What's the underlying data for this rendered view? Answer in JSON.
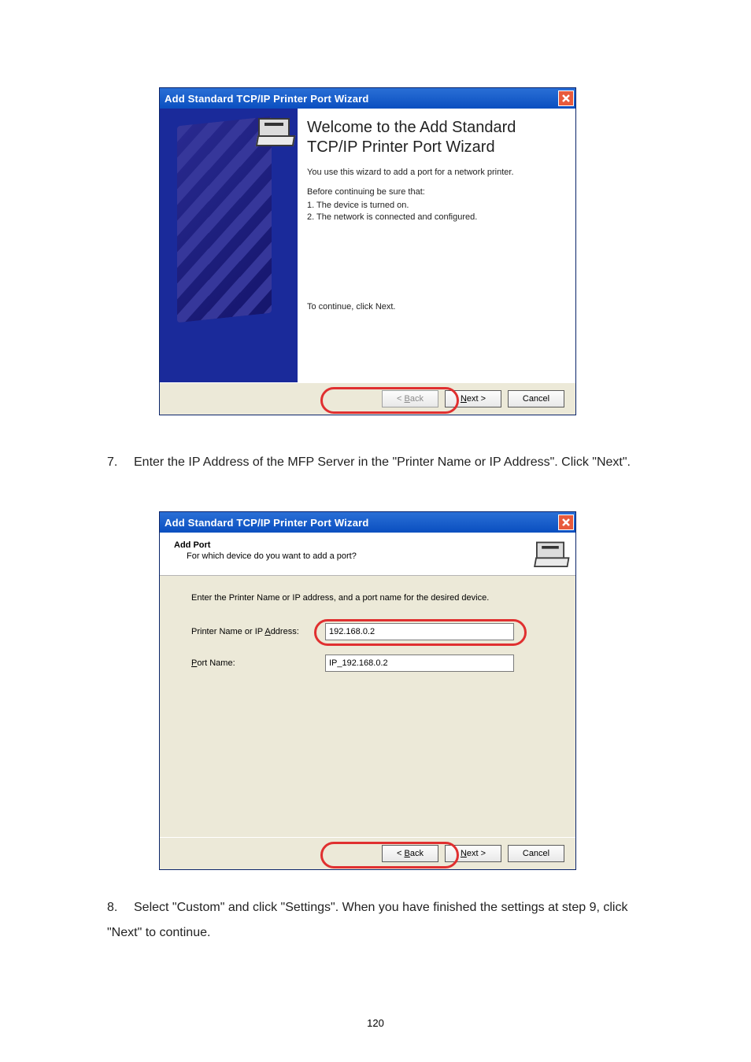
{
  "wizard_title": "Add Standard TCP/IP Printer Port Wizard",
  "close_glyph": "X",
  "dlg1": {
    "heading": "Welcome to the Add Standard TCP/IP Printer Port Wizard",
    "intro": "You use this wizard to add a port for a network printer.",
    "before": "Before continuing be sure that:",
    "b1": "1.  The device is turned on.",
    "b2": "2.  The network is connected and configured.",
    "continue": "To continue, click Next."
  },
  "dlg2": {
    "header_title": "Add Port",
    "header_sub": "For which device do you want to add a port?",
    "instruct": "Enter the Printer Name or IP address, and a port name for the desired device.",
    "label_addr_pre": "Printer Name or IP ",
    "label_addr_u": "A",
    "label_addr_post": "ddress:",
    "label_port_u": "P",
    "label_port_post": "ort Name:",
    "val_addr": "192.168.0.2",
    "val_port": "IP_192.168.0.2"
  },
  "buttons": {
    "back": "< Back",
    "back_u": "B",
    "next": "Next >",
    "next_u": "N",
    "cancel": "Cancel"
  },
  "doc": {
    "step7_num": "7.",
    "step7": "Enter the IP Address of the MFP Server in the \"Printer Name or IP Address\". Click \"Next\".",
    "step8_num": "8.",
    "step8": "Select \"Custom\" and click \"Settings\". When you have finished the settings at step 9, click \"Next\" to continue.",
    "page": "120"
  }
}
